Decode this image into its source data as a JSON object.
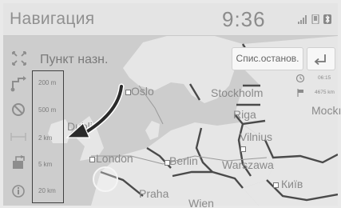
{
  "status": {
    "title": "Навигация",
    "time": "9:36"
  },
  "header": {
    "destination_title": "Пункт назн.",
    "stops_button": "Спис.останов."
  },
  "scale_options": [
    "200 m",
    "500 m",
    "2 km",
    "5 km",
    "20 km"
  ],
  "eta": {
    "arrival_time": "06:15",
    "distance": "4675 km"
  },
  "map_labels": {
    "oslo": "Oslo",
    "stockholm": "Stockholm",
    "riga": "Riga",
    "moscow": "Mockı",
    "vilnius": "Vilnius",
    "dublin": "Dubli",
    "london": "London",
    "berlin": "Berlin",
    "warszawa": "Warszawa",
    "kyiv": "Київ",
    "praha": "Praha",
    "wien": "Wien"
  },
  "icons": {
    "collapse": "fullscreen-corners-icon",
    "back": "back-arrow-icon",
    "route_options": "route-icon",
    "avoid": "no-entry-icon",
    "road": "road-icon",
    "exit": "exit-icon",
    "info": "info-icon",
    "clock": "clock-icon",
    "flag": "flag-icon"
  },
  "colors": {
    "background": "#e9e9e9",
    "land": "#e6e6e6",
    "water": "#cfcfcf",
    "border_lines": "#4a4a4a",
    "arrow": "#2a2a2a"
  }
}
